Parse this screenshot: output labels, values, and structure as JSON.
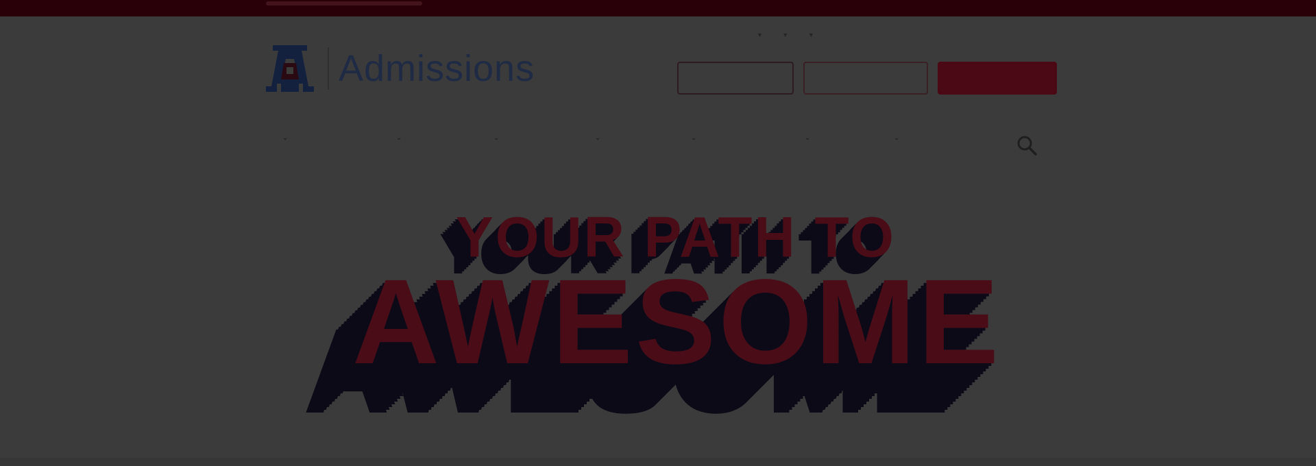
{
  "site": {
    "top_bar": {
      "link_label": ""
    },
    "utility_links": [
      {
        "label": "",
        "has_caret": true
      },
      {
        "label": "",
        "has_caret": true
      },
      {
        "label": "",
        "has_caret": true
      }
    ],
    "logo": {
      "text": "Admissions",
      "mark_letter": "A"
    },
    "cta_buttons": {
      "visit": "",
      "request_info": "",
      "apply": ""
    },
    "nav": {
      "items": [
        {
          "label": ""
        },
        {
          "label": ""
        },
        {
          "label": ""
        },
        {
          "label": ""
        },
        {
          "label": ""
        },
        {
          "label": ""
        },
        {
          "label": ""
        }
      ],
      "search_icon": "search-icon"
    },
    "hero": {
      "line1": "YOUR PATH TO",
      "line2": "AWESOME"
    },
    "colors": {
      "brand_red": "#AB0520",
      "brand_navy": "#0C234B",
      "overlay": "rgba(0,0,0,0.75)"
    }
  }
}
